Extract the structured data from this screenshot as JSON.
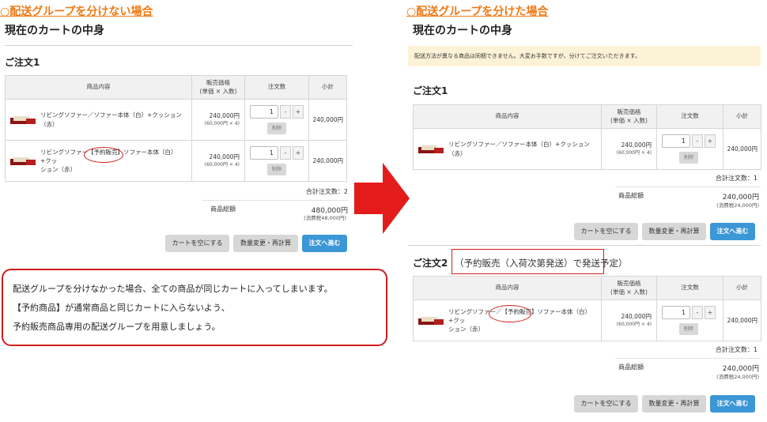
{
  "left": {
    "heading": "○配送グループを分けない場合",
    "cart_title": "現在のカートの中身",
    "order_title": "ご注文1",
    "columns": [
      "商品内容",
      "販売価格",
      "(単価 × 入数)",
      "注文数",
      "小計"
    ],
    "items": [
      {
        "name_l1": "リビングソファー／ソファー本体（白）+クッション（赤）",
        "name_l2": "",
        "price": "240,000円",
        "price_detail": "(60,000円 × 4)",
        "qty": "1",
        "minus": "-",
        "plus": "+",
        "delete": "削除",
        "subtotal": "240,000円"
      },
      {
        "name_a": "リビングソファー",
        "badge": "【予約販売】",
        "name_b": "ソファー本体（白）+クッ",
        "name_l2": "ション（赤）",
        "price": "240,000円",
        "price_detail": "(60,000円 × 4)",
        "qty": "1",
        "minus": "-",
        "plus": "+",
        "delete": "削除",
        "subtotal": "240,000円"
      }
    ],
    "total_qty": "合計注文数：2",
    "total_label": "商品総額",
    "total_value": "480,000円",
    "tax_note": "(消費税48,000円)",
    "buttons": {
      "empty": "カートを空にする",
      "update": "数量変更・再計算",
      "checkout": "注文へ進む"
    }
  },
  "callout": {
    "line1": "配送グループを分けなかった場合、全ての商品が同じカートに入ってしまいます。",
    "line2": "【予約商品】が通常商品と同じカートに入らないよう、",
    "line3": "予約販売商品専用の配送グループを用意しましょう。"
  },
  "arrow_color": "#e31b1b",
  "accent_orange": "#f07a16",
  "primary_blue": "#3b97d6",
  "right": {
    "heading": "○配送グループを分けた場合",
    "cart_title": "現在のカートの中身",
    "notice": "配送方法が異なる商品は同梱できません。大変お手数ですが、分けてご注文いただきます。",
    "columns": [
      "商品内容",
      "販売価格",
      "(単価 × 入数)",
      "注文数",
      "小計"
    ],
    "order1": {
      "title": "ご注文1",
      "item": {
        "name_l1": "リビングソファー／ソファー本体（白）+クッション（赤）",
        "price": "240,000円",
        "price_detail": "(60,000円 × 4)",
        "qty": "1",
        "minus": "-",
        "plus": "+",
        "delete": "削除",
        "subtotal": "240,000円"
      },
      "total_qty": "合計注文数：1",
      "total_label": "商品総額",
      "total_value": "240,000円",
      "tax_note": "(消費税24,000円)"
    },
    "order2": {
      "title": "ご注文2",
      "note": "（予約販売（入荷次第発送）で発送予定）",
      "item": {
        "name_a": "リビングソファー／",
        "badge": "【予約販売】",
        "name_b": "ソファー本体（白）+クッ",
        "name_l2": "ション（赤）",
        "price": "240,000円",
        "price_detail": "(60,000円 × 4)",
        "qty": "1",
        "minus": "-",
        "plus": "+",
        "delete": "削除",
        "subtotal": "240,000円"
      },
      "total_qty": "合計注文数：1",
      "total_label": "商品総額",
      "total_value": "240,000円",
      "tax_note": "(消費税24,000円)"
    },
    "buttons": {
      "empty": "カートを空にする",
      "update": "数量変更・再計算",
      "checkout": "注文へ進む"
    }
  }
}
